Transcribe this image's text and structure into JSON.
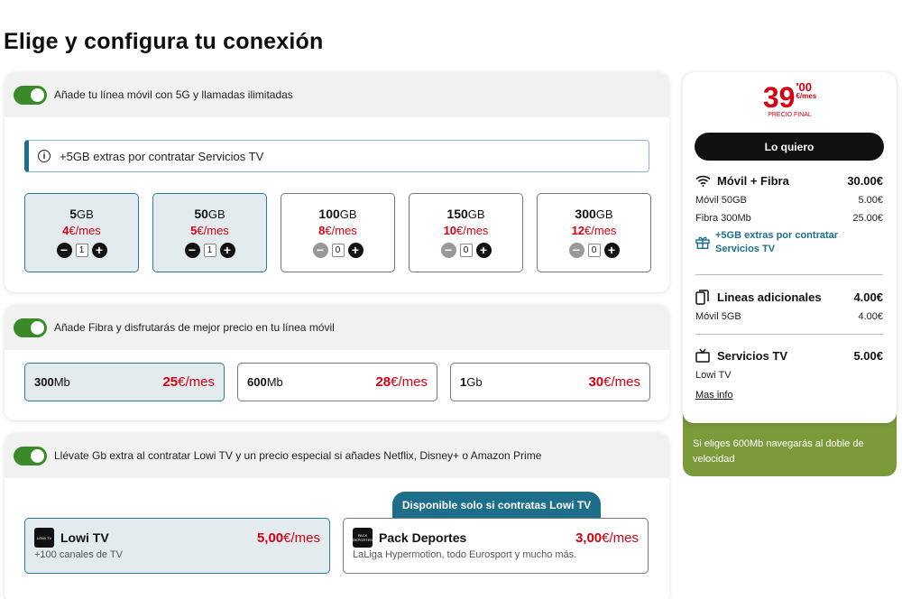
{
  "page_title": "Elige y configura tu conexión",
  "mobile": {
    "toggle_label": "Añade tu línea móvil con 5G y llamadas ilimitadas",
    "info": "+5GB extras por contratar Servicios TV",
    "plans": [
      {
        "gb": "5",
        "unit": "GB",
        "price": "4",
        "price_unit": "€/mes",
        "qty": "1",
        "selected": true
      },
      {
        "gb": "50",
        "unit": "GB",
        "price": "5",
        "price_unit": "€/mes",
        "qty": "1",
        "selected": true
      },
      {
        "gb": "100",
        "unit": "GB",
        "price": "8",
        "price_unit": "€/mes",
        "qty": "0",
        "selected": false
      },
      {
        "gb": "150",
        "unit": "GB",
        "price": "10",
        "price_unit": "€/mes",
        "qty": "0",
        "selected": false
      },
      {
        "gb": "300",
        "unit": "GB",
        "price": "12",
        "price_unit": "€/mes",
        "qty": "0",
        "selected": false
      }
    ]
  },
  "fiber": {
    "toggle_label": "Añade Fibra y disfrutarás de mejor precio en tu línea móvil",
    "options": [
      {
        "speed": "300",
        "unit": "Mb",
        "price": "25",
        "price_unit": "€/mes",
        "selected": true
      },
      {
        "speed": "600",
        "unit": "Mb",
        "price": "28",
        "price_unit": "€/mes",
        "selected": false
      },
      {
        "speed": "1",
        "unit": "Gb",
        "price": "30",
        "price_unit": "€/mes",
        "selected": false
      }
    ]
  },
  "tv": {
    "toggle_label": "Llévate Gb extra al contratar Lowi TV y un precio especial si añades Netflix, Disney+ o Amazon Prime",
    "availability_tab": "Disponible solo si contratas Lowi TV",
    "items": [
      {
        "name": "Lowi TV",
        "logo_text": "LOWI TV",
        "price": "5,00",
        "price_unit": "€/mes",
        "subtitle": "+100 canales de TV",
        "selected": true
      },
      {
        "name": "Pack Deportes",
        "logo_text": "PACK DEPORTES",
        "price": "3,00",
        "price_unit": "€/mes",
        "subtitle": "LaLiga Hypermotion, todo Eurosport y mucho más.",
        "selected": false
      }
    ]
  },
  "summary": {
    "price_integer": "39",
    "price_decimal": "'00",
    "price_unit": "€/mes",
    "price_label": "PRECIO FINAL",
    "cta_label": "Lo quiero",
    "movil_fibra": {
      "title": "Móvil + Fibra",
      "amount": "30.00€",
      "lines": [
        {
          "label": "Móvil 50GB",
          "amount": "5.00€"
        },
        {
          "label": "Fibra 300Mb",
          "amount": "25.00€"
        }
      ],
      "gift": "+5GB extras por contratar Servicios TV"
    },
    "lineas": {
      "title": "Lineas adicionales",
      "amount": "4.00€",
      "lines": [
        {
          "label": "Móvil 5GB",
          "amount": "4.00€"
        }
      ]
    },
    "servicios": {
      "title": "Servicios TV",
      "amount": "5.00€",
      "lines": [
        {
          "label": "Lowi TV"
        }
      ],
      "more": "Mas info"
    },
    "promo": "Si eliges 600Mb navegarás al doble de velocidad"
  },
  "colors": {
    "accent_red": "#d4000f",
    "teal": "#1c6e8a",
    "green_toggle": "#3a8a2a",
    "olive_promo": "#7b9a3a"
  }
}
